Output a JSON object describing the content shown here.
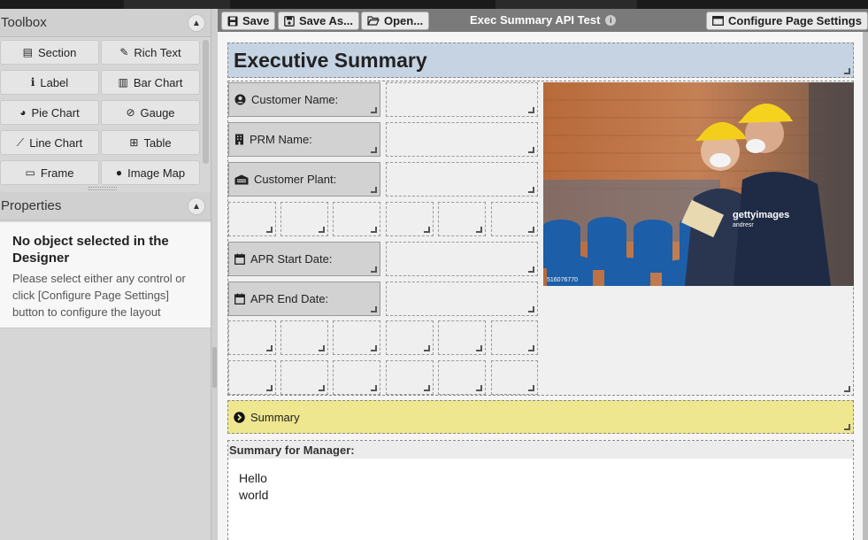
{
  "toolbox": {
    "title": "Toolbox",
    "collapse_icon": "chevron-up-icon",
    "tools": [
      {
        "label": "Section",
        "icon": "section-icon",
        "glyph": "▤"
      },
      {
        "label": "Rich Text",
        "icon": "brush-icon",
        "glyph": "🖌"
      },
      {
        "label": "Label",
        "icon": "info-icon",
        "glyph": "ℹ"
      },
      {
        "label": "Bar Chart",
        "icon": "bar-chart-icon",
        "glyph": "▥"
      },
      {
        "label": "Pie Chart",
        "icon": "pie-chart-icon",
        "glyph": "◕"
      },
      {
        "label": "Gauge",
        "icon": "gauge-icon",
        "glyph": "⊘"
      },
      {
        "label": "Line Chart",
        "icon": "line-chart-icon",
        "glyph": "📈"
      },
      {
        "label": "Table",
        "icon": "table-icon",
        "glyph": "⊞"
      },
      {
        "label": "Frame",
        "icon": "frame-icon",
        "glyph": "▭"
      },
      {
        "label": "Image Map",
        "icon": "map-pin-icon",
        "glyph": "📍"
      }
    ]
  },
  "properties": {
    "title": "Properties",
    "heading": "No object selected in the Designer",
    "text": "Please select either any control or click [Configure Page Settings] button to configure the layout"
  },
  "toolbar": {
    "save": "Save",
    "save_as": "Save As...",
    "open": "Open...",
    "document_title": "Exec Summary API Test",
    "configure": "Configure Page Settings"
  },
  "report": {
    "title": "Executive Summary",
    "customer_name": "Customer Name:",
    "prm_name": "PRM Name:",
    "customer_plant": "Customer Plant:",
    "apr_start": "APR Start Date:",
    "apr_end": "APR End Date:",
    "summary": "Summary",
    "summary_manager_label": "Summary for Manager:",
    "summary_manager_text": "Hello\nworld",
    "image_watermark": "gettyimages",
    "image_credit": "andresr",
    "image_id": "516076770"
  },
  "colors": {
    "title_band": "#c5d3e3",
    "summary_band": "#efe690",
    "toolbar_bg": "#7a7a7a"
  }
}
